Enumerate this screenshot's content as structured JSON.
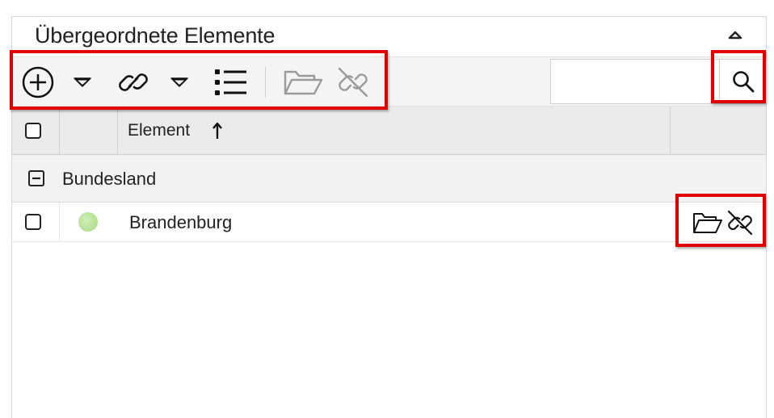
{
  "panel": {
    "title": "Übergeordnete Elemente",
    "collapse_icon": "chevron-up-icon"
  },
  "toolbar": {
    "icons": [
      "add-circle-icon",
      "dropdown-arrow-icon",
      "link-icon",
      "dropdown-arrow-icon",
      "list-icon",
      "folder-open-icon",
      "unlink-icon"
    ],
    "search": {
      "value": "",
      "placeholder": ""
    },
    "search_icon": "search-icon"
  },
  "table": {
    "columns": [
      "",
      "",
      "Element",
      ""
    ],
    "sort": {
      "column": "Element",
      "direction": "ascending"
    },
    "groups": [
      {
        "label": "Bundesland",
        "expanded": true,
        "rows": [
          {
            "label": "Brandenburg",
            "status_color": "#a8d888",
            "actions": [
              "folder-open-icon",
              "unlink-icon"
            ]
          }
        ]
      }
    ]
  },
  "colors": {
    "highlight": "#e00000",
    "toolbar_bg": "#f4f4f4",
    "header_bg": "#ebebeb",
    "disabled_icon": "#9a9a9a"
  }
}
